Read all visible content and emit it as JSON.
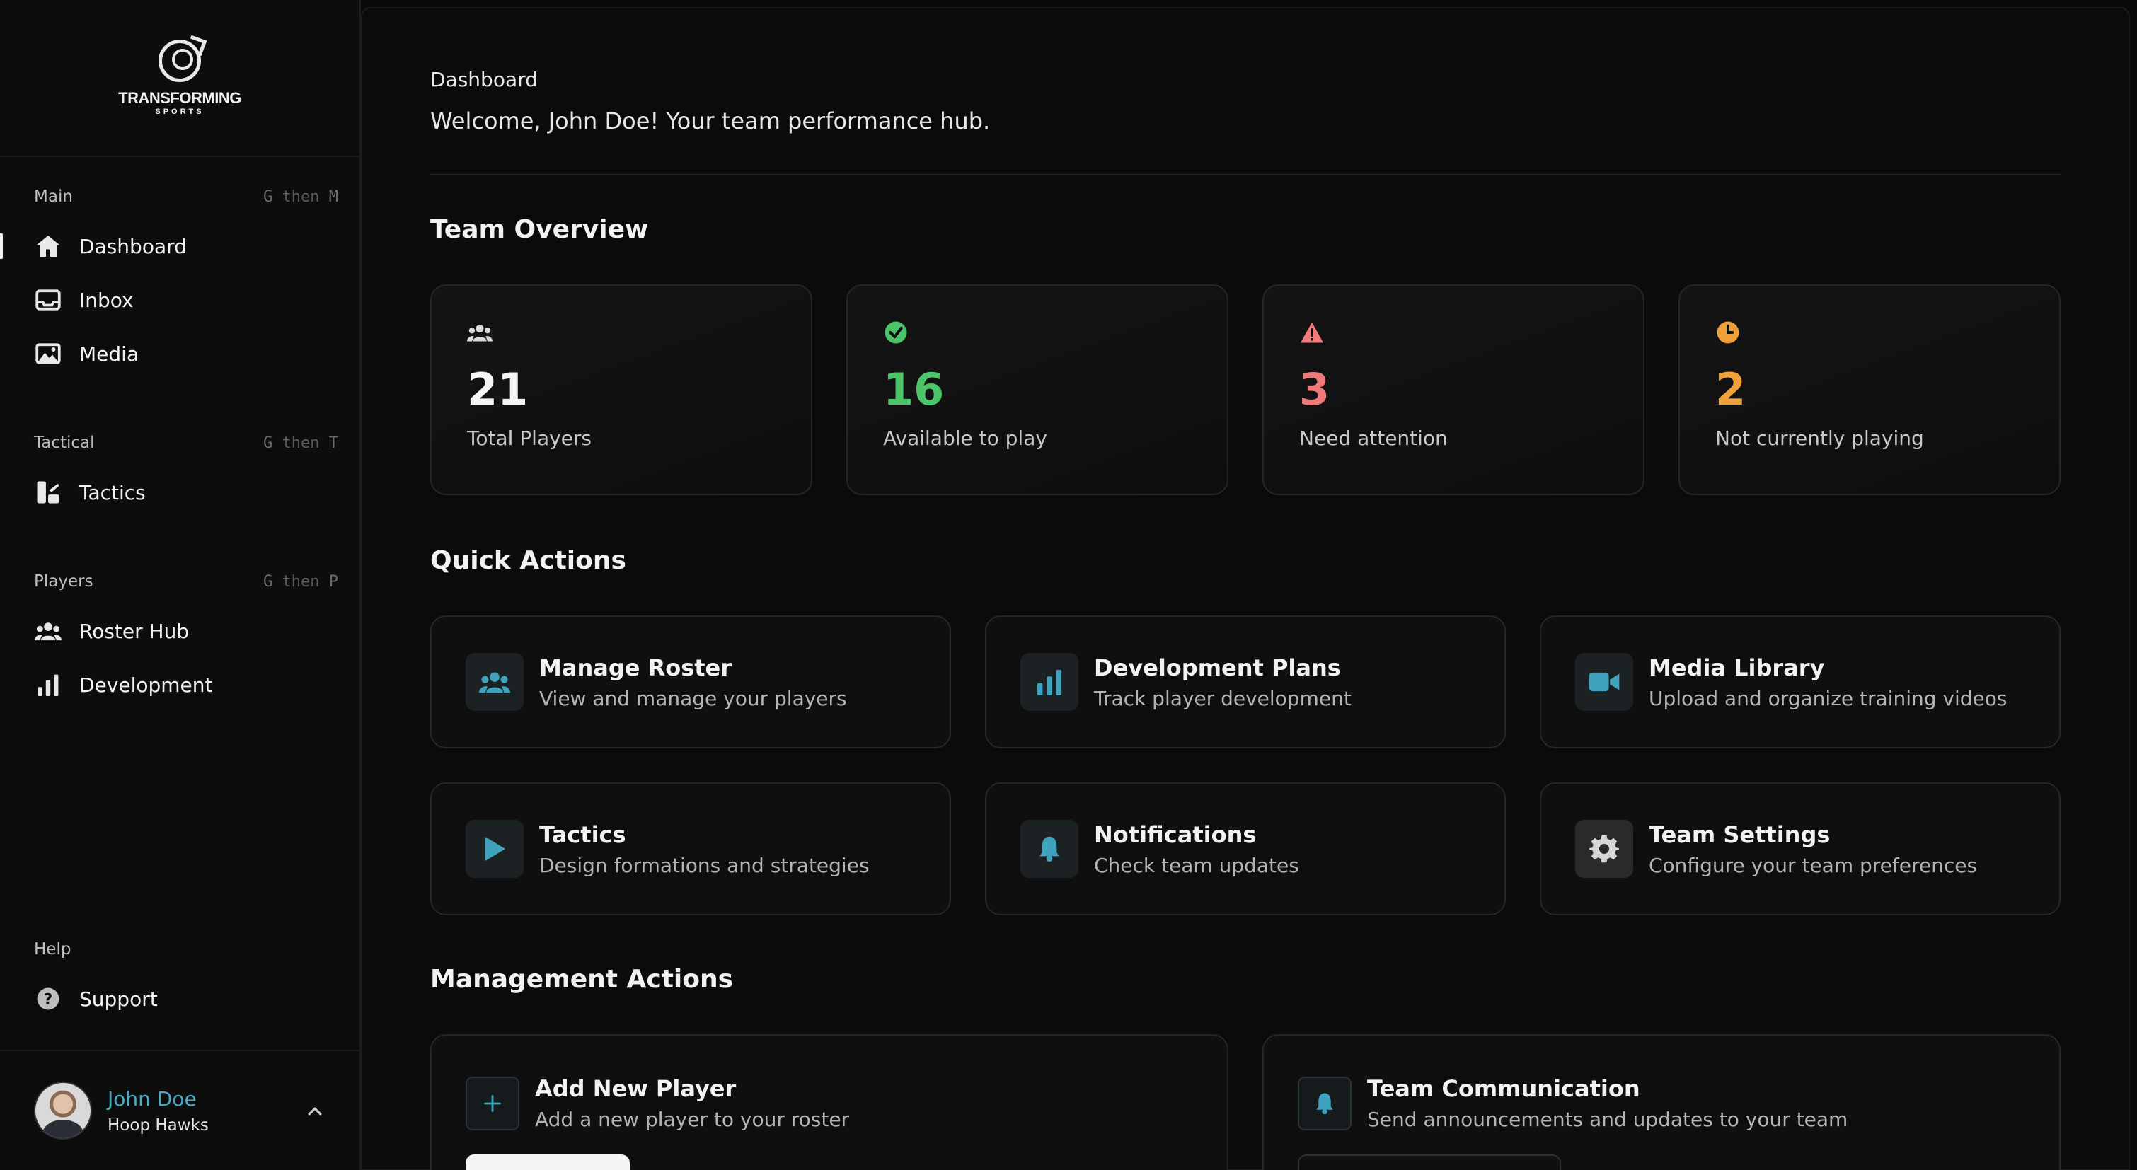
{
  "brand": {
    "name": "TRANSFORMING",
    "sub": "SPORTS"
  },
  "sidebar": {
    "groups": [
      {
        "title": "Main",
        "shortcut": {
          "key1": "G",
          "then": "then",
          "key2": "M"
        },
        "items": [
          {
            "label": "Dashboard",
            "icon": "home-icon"
          },
          {
            "label": "Inbox",
            "icon": "inbox-icon"
          },
          {
            "label": "Media",
            "icon": "image-icon"
          }
        ]
      },
      {
        "title": "Tactical",
        "shortcut": {
          "key1": "G",
          "then": "then",
          "key2": "T"
        },
        "items": [
          {
            "label": "Tactics",
            "icon": "tactics-icon"
          }
        ]
      },
      {
        "title": "Players",
        "shortcut": {
          "key1": "G",
          "then": "then",
          "key2": "P"
        },
        "items": [
          {
            "label": "Roster Hub",
            "icon": "users-icon"
          },
          {
            "label": "Development",
            "icon": "bar-chart-icon"
          }
        ]
      },
      {
        "title": "Help",
        "items": [
          {
            "label": "Support",
            "icon": "question-icon"
          }
        ]
      }
    ],
    "active": "Dashboard"
  },
  "user": {
    "name": "John Doe",
    "team": "Hoop Hawks"
  },
  "header": {
    "title": "Dashboard",
    "subtitle": "Welcome, John Doe! Your team performance hub."
  },
  "overview": {
    "title": "Team Overview",
    "stats": [
      {
        "value": "21",
        "label": "Total Players",
        "color": "#f5f5f5",
        "icon": "users-icon"
      },
      {
        "value": "16",
        "label": "Available to play",
        "color": "#4cc46a",
        "icon": "check-circle-icon"
      },
      {
        "value": "3",
        "label": "Need attention",
        "color": "#f07a7a",
        "icon": "warning-icon"
      },
      {
        "value": "2",
        "label": "Not currently playing",
        "color": "#f0a23a",
        "icon": "clock-icon"
      }
    ]
  },
  "quick_actions": {
    "title": "Quick Actions",
    "items": [
      {
        "title": "Manage Roster",
        "desc": "View and manage your players",
        "icon": "users-icon"
      },
      {
        "title": "Development Plans",
        "desc": "Track player development",
        "icon": "bar-chart-icon"
      },
      {
        "title": "Media Library",
        "desc": "Upload and organize training videos",
        "icon": "video-icon"
      },
      {
        "title": "Tactics",
        "desc": "Design formations and strategies",
        "icon": "play-icon"
      },
      {
        "title": "Notifications",
        "desc": "Check team updates",
        "icon": "bell-icon"
      },
      {
        "title": "Team Settings",
        "desc": "Configure your team preferences",
        "icon": "gear-icon"
      }
    ]
  },
  "management": {
    "title": "Management Actions",
    "items": [
      {
        "title": "Add New Player",
        "desc": "Add a new player to your roster",
        "icon": "plus-icon"
      },
      {
        "title": "Team Communication",
        "desc": "Send announcements and updates to your team",
        "icon": "bell-icon"
      }
    ]
  },
  "colors": {
    "accent": "#3fa3bd",
    "background": "#0a0a0a"
  }
}
